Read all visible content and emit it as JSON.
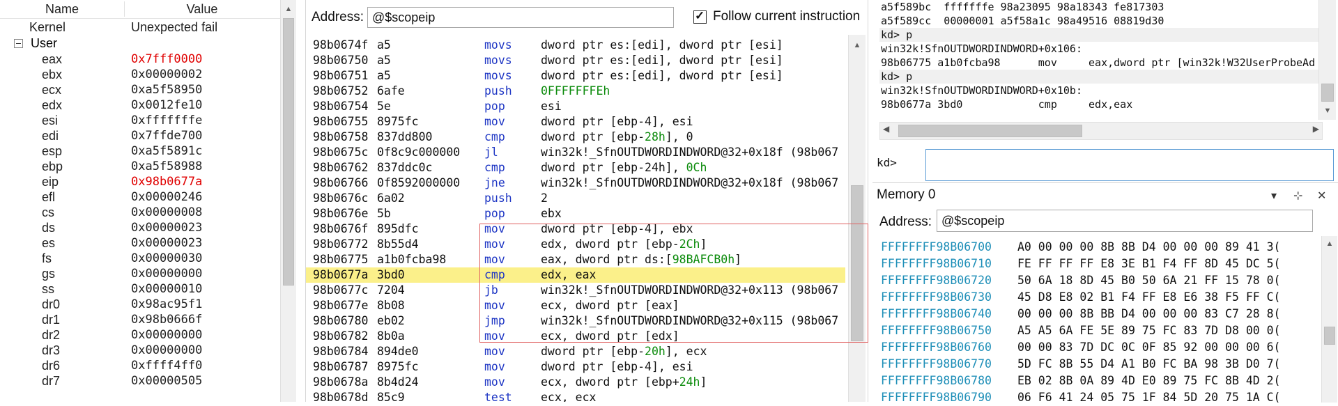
{
  "registers": {
    "col_name": "Name",
    "col_value": "Value",
    "kernel": {
      "name": "Kernel",
      "value": "Unexpected fail"
    },
    "group": "User",
    "rows": [
      {
        "name": "eax",
        "value": "0x7fff0000",
        "changed": true
      },
      {
        "name": "ebx",
        "value": "0x00000002",
        "changed": false
      },
      {
        "name": "ecx",
        "value": "0xa5f58950",
        "changed": false
      },
      {
        "name": "edx",
        "value": "0x0012fe10",
        "changed": false
      },
      {
        "name": "esi",
        "value": "0xfffffffe",
        "changed": false
      },
      {
        "name": "edi",
        "value": "0x7ffde700",
        "changed": false
      },
      {
        "name": "esp",
        "value": "0xa5f5891c",
        "changed": false
      },
      {
        "name": "ebp",
        "value": "0xa5f58988",
        "changed": false
      },
      {
        "name": "eip",
        "value": "0x98b0677a",
        "changed": true
      },
      {
        "name": "efl",
        "value": "0x00000246",
        "changed": false
      },
      {
        "name": "cs",
        "value": "0x00000008",
        "changed": false
      },
      {
        "name": "ds",
        "value": "0x00000023",
        "changed": false
      },
      {
        "name": "es",
        "value": "0x00000023",
        "changed": false
      },
      {
        "name": "fs",
        "value": "0x00000030",
        "changed": false
      },
      {
        "name": "gs",
        "value": "0x00000000",
        "changed": false
      },
      {
        "name": "ss",
        "value": "0x00000010",
        "changed": false
      },
      {
        "name": "dr0",
        "value": "0x98ac95f1",
        "changed": false
      },
      {
        "name": "dr1",
        "value": "0x98b0666f",
        "changed": false
      },
      {
        "name": "dr2",
        "value": "0x00000000",
        "changed": false
      },
      {
        "name": "dr3",
        "value": "0x00000000",
        "changed": false
      },
      {
        "name": "dr6",
        "value": "0xffff4ff0",
        "changed": false
      },
      {
        "name": "dr7",
        "value": "0x00000505",
        "changed": false
      }
    ]
  },
  "disassembly": {
    "address_label": "Address:",
    "address_value": "@$scopeip",
    "follow_label": "Follow current instruction",
    "follow_checked": true,
    "current_index": 15,
    "rows": [
      {
        "addr": "98b0674f",
        "bytes": "a5",
        "mn": "movs",
        "op": "dword ptr es:[edi], dword ptr [esi]"
      },
      {
        "addr": "98b06750",
        "bytes": "a5",
        "mn": "movs",
        "op": "dword ptr es:[edi], dword ptr [esi]"
      },
      {
        "addr": "98b06751",
        "bytes": "a5",
        "mn": "movs",
        "op": "dword ptr es:[edi], dword ptr [esi]"
      },
      {
        "addr": "98b06752",
        "bytes": "6afe",
        "mn": "push",
        "op": "",
        "num": "0FFFFFFFEh",
        "after": ""
      },
      {
        "addr": "98b06754",
        "bytes": "5e",
        "mn": "pop",
        "op": "esi"
      },
      {
        "addr": "98b06755",
        "bytes": "8975fc",
        "mn": "mov",
        "op": "dword ptr [ebp-4], esi"
      },
      {
        "addr": "98b06758",
        "bytes": "837dd800",
        "mn": "cmp",
        "op": "dword ptr [ebp-",
        "num": "28h",
        "after": "], 0"
      },
      {
        "addr": "98b0675c",
        "bytes": "0f8c9c000000",
        "mn": "jl",
        "op": "win32k!_SfnOUTDWORDINDWORD@32+0x18f (98b067"
      },
      {
        "addr": "98b06762",
        "bytes": "837ddc0c",
        "mn": "cmp",
        "op": "dword ptr [ebp-24h], ",
        "num": "0Ch",
        "after": ""
      },
      {
        "addr": "98b06766",
        "bytes": "0f8592000000",
        "mn": "jne",
        "op": "win32k!_SfnOUTDWORDINDWORD@32+0x18f (98b067"
      },
      {
        "addr": "98b0676c",
        "bytes": "6a02",
        "mn": "push",
        "op": "2"
      },
      {
        "addr": "98b0676e",
        "bytes": "5b",
        "mn": "pop",
        "op": "ebx"
      },
      {
        "addr": "98b0676f",
        "bytes": "895dfc",
        "mn": "mov",
        "op": "dword ptr [ebp-4], ebx"
      },
      {
        "addr": "98b06772",
        "bytes": "8b55d4",
        "mn": "mov",
        "op": "edx, dword ptr [ebp-",
        "num": "2Ch",
        "after": "]"
      },
      {
        "addr": "98b06775",
        "bytes": "a1b0fcba98",
        "mn": "mov",
        "op": "eax, dword ptr ds:[",
        "num": "98BAFCB0h",
        "after": "]"
      },
      {
        "addr": "98b0677a",
        "bytes": "3bd0",
        "mn": "cmp",
        "op": "edx, eax"
      },
      {
        "addr": "98b0677c",
        "bytes": "7204",
        "mn": "jb",
        "op": "win32k!_SfnOUTDWORDINDWORD@32+0x113 (98b067"
      },
      {
        "addr": "98b0677e",
        "bytes": "8b08",
        "mn": "mov",
        "op": "ecx, dword ptr [eax]"
      },
      {
        "addr": "98b06780",
        "bytes": "eb02",
        "mn": "jmp",
        "op": "win32k!_SfnOUTDWORDINDWORD@32+0x115 (98b067"
      },
      {
        "addr": "98b06782",
        "bytes": "8b0a",
        "mn": "mov",
        "op": "ecx, dword ptr [edx]"
      },
      {
        "addr": "98b06784",
        "bytes": "894de0",
        "mn": "mov",
        "op": "dword ptr [ebp-",
        "num": "20h",
        "after": "], ecx"
      },
      {
        "addr": "98b06787",
        "bytes": "8975fc",
        "mn": "mov",
        "op": "dword ptr [ebp-4], esi"
      },
      {
        "addr": "98b0678a",
        "bytes": "8b4d24",
        "mn": "mov",
        "op": "ecx, dword ptr [ebp+",
        "num": "24h",
        "after": "]"
      },
      {
        "addr": "98b0678d",
        "bytes": "85c9",
        "mn": "test",
        "op": "ecx, ecx"
      }
    ]
  },
  "command": {
    "lines": [
      {
        "text": "a5f589bc  fffffffe 98a23095 98a18343 fe817303",
        "hl": false
      },
      {
        "text": "a5f589cc  00000001 a5f58a1c 98a49516 08819d30",
        "hl": false
      },
      {
        "text": "kd> p",
        "hl": true
      },
      {
        "text": "win32k!SfnOUTDWORDINDWORD+0x106:",
        "hl": false
      },
      {
        "text": "98b06775 a1b0fcba98      mov     eax,dword ptr [win32k!W32UserProbeAd",
        "hl": false
      },
      {
        "text": "kd> p",
        "hl": true
      },
      {
        "text": "win32k!SfnOUTDWORDINDWORD+0x10b:",
        "hl": false
      },
      {
        "text": "98b0677a 3bd0            cmp     edx,eax",
        "hl": false
      }
    ],
    "prompt": "kd>",
    "input_value": ""
  },
  "memory": {
    "title": "Memory 0",
    "address_label": "Address:",
    "address_value": "@$scopeip",
    "rows": [
      {
        "addr": "FFFFFFFF98B06700",
        "bytes": "A0 00 00 00 8B 8B D4 00 00 00 89 41 3("
      },
      {
        "addr": "FFFFFFFF98B06710",
        "bytes": "FE FF FF FF E8 3E B1 F4 FF 8D 45 DC 5("
      },
      {
        "addr": "FFFFFFFF98B06720",
        "bytes": "50 6A 18 8D 45 B0 50 6A 21 FF 15 78 0("
      },
      {
        "addr": "FFFFFFFF98B06730",
        "bytes": "45 D8 E8 02 B1 F4 FF E8 E6 38 F5 FF C("
      },
      {
        "addr": "FFFFFFFF98B06740",
        "bytes": "00 00 00 8B BB D4 00 00 00 83 C7 28 8("
      },
      {
        "addr": "FFFFFFFF98B06750",
        "bytes": "A5 A5 6A FE 5E 89 75 FC 83 7D D8 00 0("
      },
      {
        "addr": "FFFFFFFF98B06760",
        "bytes": "00 00 83 7D DC 0C 0F 85 92 00 00 00 6("
      },
      {
        "addr": "FFFFFFFF98B06770",
        "bytes": "5D FC 8B 55 D4 A1 B0 FC BA 98 3B D0 7("
      },
      {
        "addr": "FFFFFFFF98B06780",
        "bytes": "EB 02 8B 0A 89 4D E0 89 75 FC 8B 4D 2("
      },
      {
        "addr": "FFFFFFFF98B06790",
        "bytes": "06 F6 41 24 05 75 1F 84 5D 20 75 1A C("
      }
    ]
  },
  "icons": {
    "check": "✓",
    "up_arrow": "▲",
    "down_arrow": "▼",
    "left_arrow": "◀",
    "right_arrow": "▶",
    "dropdown": "▾",
    "pin": "⊹",
    "close": "✕"
  }
}
